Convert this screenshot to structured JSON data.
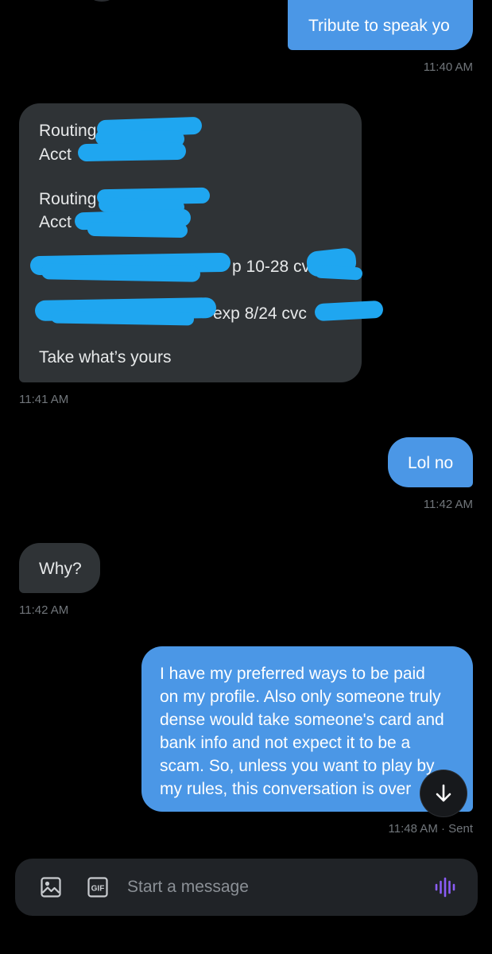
{
  "messages": [
    {
      "direction": "outgoing",
      "text": "Tribute to speak yo",
      "time": "11:40 AM"
    },
    {
      "direction": "incoming",
      "lines": [
        "Routing",
        "Acct",
        "Routing",
        "Acct",
        "p 10-28 cvc",
        "exp 8/24 cvc",
        "Take what’s yours"
      ],
      "time": "11:41 AM"
    },
    {
      "direction": "outgoing",
      "text": "Lol no",
      "time": "11:42 AM"
    },
    {
      "direction": "incoming",
      "text": "Why?",
      "time": "11:42 AM"
    },
    {
      "direction": "outgoing",
      "lines": [
        "I have my preferred ways to be paid",
        "on my profile. Also only someone truly",
        "dense would take someone's card and",
        "bank info and not expect it to be a",
        "scam. So, unless you want to play by",
        "my rules, this conversation is over"
      ],
      "time": "11:48 AM · Sent"
    }
  ],
  "composer": {
    "placeholder": "Start a message",
    "gif_label": "GIF"
  },
  "icons": {
    "image": "image-icon",
    "gif": "gif-icon",
    "voice": "voice-wave-icon",
    "scroll": "arrow-down-icon"
  },
  "colors": {
    "outgoing_bubble": "#4b97e6",
    "incoming_bubble": "#2f3336",
    "redaction": "#1fa6f0",
    "voice_icon": "#8a5cf6",
    "timestamp": "#71767b"
  }
}
